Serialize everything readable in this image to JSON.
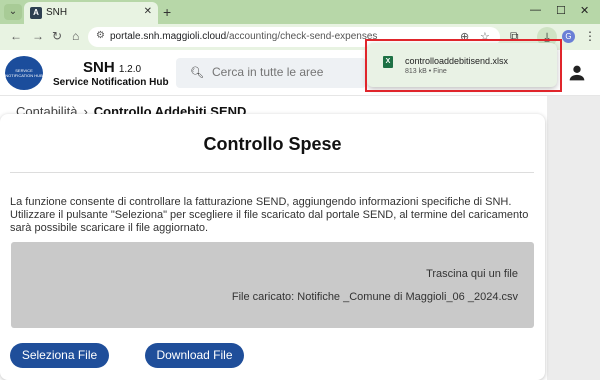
{
  "browser": {
    "tab_title": "SNH",
    "tab_favicon": "A",
    "url_host": "portale.snh.maggioli.cloud",
    "url_path": "/accounting/check-send-expenses",
    "profile_initial": "G"
  },
  "download": {
    "filename": "controlloaddebitisend.xlsx",
    "meta": "813 kB • Fine",
    "icon": "excel-icon"
  },
  "header": {
    "app_name": "SNH",
    "version": "1.2.0",
    "subtitle": "Service Notification Hub",
    "logo_text": "SERVICE NOTIFICATION HUB",
    "search_placeholder": "Cerca in tutte le aree"
  },
  "breadcrumb": {
    "parent": "Contabilità",
    "current": "Controllo Addebiti SEND"
  },
  "main": {
    "title": "Controllo Spese",
    "description": "La funzione consente di controllare la fatturazione SEND, aggiungendo informazioni specifiche di SNH. Utilizzare il pulsante \"Seleziona\" per scegliere il file scaricato dal portale SEND, al termine del caricamento sarà possibile scaricare il file aggiornato.",
    "dropzone_text": "Trascina qui un file",
    "uploaded_file": "File caricato: Notifiche _Comune di Maggioli_06 _2024.csv",
    "select_button": "Seleziona File",
    "download_button": "Download File"
  },
  "colors": {
    "primary": "#1f4e9a",
    "browser_accent": "#b7d7a8",
    "highlight": "#e0252b"
  }
}
